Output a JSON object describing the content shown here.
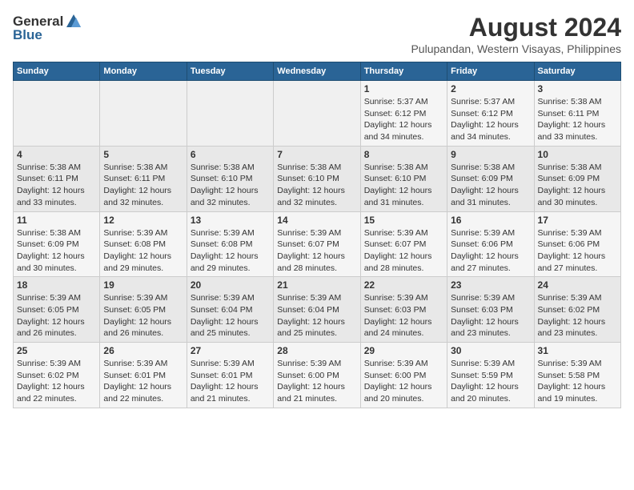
{
  "logo": {
    "general": "General",
    "blue": "Blue"
  },
  "title": "August 2024",
  "subtitle": "Pulupandan, Western Visayas, Philippines",
  "days_header": [
    "Sunday",
    "Monday",
    "Tuesday",
    "Wednesday",
    "Thursday",
    "Friday",
    "Saturday"
  ],
  "weeks": [
    [
      {
        "day": "",
        "content": ""
      },
      {
        "day": "",
        "content": ""
      },
      {
        "day": "",
        "content": ""
      },
      {
        "day": "",
        "content": ""
      },
      {
        "day": "1",
        "content": "Sunrise: 5:37 AM\nSunset: 6:12 PM\nDaylight: 12 hours\nand 34 minutes."
      },
      {
        "day": "2",
        "content": "Sunrise: 5:37 AM\nSunset: 6:12 PM\nDaylight: 12 hours\nand 34 minutes."
      },
      {
        "day": "3",
        "content": "Sunrise: 5:38 AM\nSunset: 6:11 PM\nDaylight: 12 hours\nand 33 minutes."
      }
    ],
    [
      {
        "day": "4",
        "content": "Sunrise: 5:38 AM\nSunset: 6:11 PM\nDaylight: 12 hours\nand 33 minutes."
      },
      {
        "day": "5",
        "content": "Sunrise: 5:38 AM\nSunset: 6:11 PM\nDaylight: 12 hours\nand 32 minutes."
      },
      {
        "day": "6",
        "content": "Sunrise: 5:38 AM\nSunset: 6:10 PM\nDaylight: 12 hours\nand 32 minutes."
      },
      {
        "day": "7",
        "content": "Sunrise: 5:38 AM\nSunset: 6:10 PM\nDaylight: 12 hours\nand 32 minutes."
      },
      {
        "day": "8",
        "content": "Sunrise: 5:38 AM\nSunset: 6:10 PM\nDaylight: 12 hours\nand 31 minutes."
      },
      {
        "day": "9",
        "content": "Sunrise: 5:38 AM\nSunset: 6:09 PM\nDaylight: 12 hours\nand 31 minutes."
      },
      {
        "day": "10",
        "content": "Sunrise: 5:38 AM\nSunset: 6:09 PM\nDaylight: 12 hours\nand 30 minutes."
      }
    ],
    [
      {
        "day": "11",
        "content": "Sunrise: 5:38 AM\nSunset: 6:09 PM\nDaylight: 12 hours\nand 30 minutes."
      },
      {
        "day": "12",
        "content": "Sunrise: 5:39 AM\nSunset: 6:08 PM\nDaylight: 12 hours\nand 29 minutes."
      },
      {
        "day": "13",
        "content": "Sunrise: 5:39 AM\nSunset: 6:08 PM\nDaylight: 12 hours\nand 29 minutes."
      },
      {
        "day": "14",
        "content": "Sunrise: 5:39 AM\nSunset: 6:07 PM\nDaylight: 12 hours\nand 28 minutes."
      },
      {
        "day": "15",
        "content": "Sunrise: 5:39 AM\nSunset: 6:07 PM\nDaylight: 12 hours\nand 28 minutes."
      },
      {
        "day": "16",
        "content": "Sunrise: 5:39 AM\nSunset: 6:06 PM\nDaylight: 12 hours\nand 27 minutes."
      },
      {
        "day": "17",
        "content": "Sunrise: 5:39 AM\nSunset: 6:06 PM\nDaylight: 12 hours\nand 27 minutes."
      }
    ],
    [
      {
        "day": "18",
        "content": "Sunrise: 5:39 AM\nSunset: 6:05 PM\nDaylight: 12 hours\nand 26 minutes."
      },
      {
        "day": "19",
        "content": "Sunrise: 5:39 AM\nSunset: 6:05 PM\nDaylight: 12 hours\nand 26 minutes."
      },
      {
        "day": "20",
        "content": "Sunrise: 5:39 AM\nSunset: 6:04 PM\nDaylight: 12 hours\nand 25 minutes."
      },
      {
        "day": "21",
        "content": "Sunrise: 5:39 AM\nSunset: 6:04 PM\nDaylight: 12 hours\nand 25 minutes."
      },
      {
        "day": "22",
        "content": "Sunrise: 5:39 AM\nSunset: 6:03 PM\nDaylight: 12 hours\nand 24 minutes."
      },
      {
        "day": "23",
        "content": "Sunrise: 5:39 AM\nSunset: 6:03 PM\nDaylight: 12 hours\nand 23 minutes."
      },
      {
        "day": "24",
        "content": "Sunrise: 5:39 AM\nSunset: 6:02 PM\nDaylight: 12 hours\nand 23 minutes."
      }
    ],
    [
      {
        "day": "25",
        "content": "Sunrise: 5:39 AM\nSunset: 6:02 PM\nDaylight: 12 hours\nand 22 minutes."
      },
      {
        "day": "26",
        "content": "Sunrise: 5:39 AM\nSunset: 6:01 PM\nDaylight: 12 hours\nand 22 minutes."
      },
      {
        "day": "27",
        "content": "Sunrise: 5:39 AM\nSunset: 6:01 PM\nDaylight: 12 hours\nand 21 minutes."
      },
      {
        "day": "28",
        "content": "Sunrise: 5:39 AM\nSunset: 6:00 PM\nDaylight: 12 hours\nand 21 minutes."
      },
      {
        "day": "29",
        "content": "Sunrise: 5:39 AM\nSunset: 6:00 PM\nDaylight: 12 hours\nand 20 minutes."
      },
      {
        "day": "30",
        "content": "Sunrise: 5:39 AM\nSunset: 5:59 PM\nDaylight: 12 hours\nand 20 minutes."
      },
      {
        "day": "31",
        "content": "Sunrise: 5:39 AM\nSunset: 5:58 PM\nDaylight: 12 hours\nand 19 minutes."
      }
    ]
  ]
}
